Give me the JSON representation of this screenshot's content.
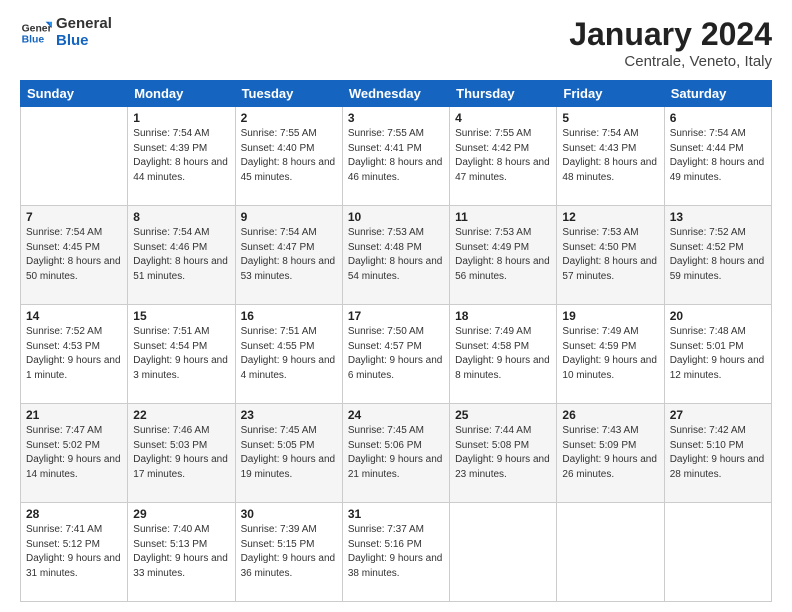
{
  "header": {
    "logo_general": "General",
    "logo_blue": "Blue",
    "month_year": "January 2024",
    "location": "Centrale, Veneto, Italy"
  },
  "days_of_week": [
    "Sunday",
    "Monday",
    "Tuesday",
    "Wednesday",
    "Thursday",
    "Friday",
    "Saturday"
  ],
  "weeks": [
    [
      {
        "day": "",
        "sunrise": "",
        "sunset": "",
        "daylight": ""
      },
      {
        "day": "1",
        "sunrise": "Sunrise: 7:54 AM",
        "sunset": "Sunset: 4:39 PM",
        "daylight": "Daylight: 8 hours and 44 minutes."
      },
      {
        "day": "2",
        "sunrise": "Sunrise: 7:55 AM",
        "sunset": "Sunset: 4:40 PM",
        "daylight": "Daylight: 8 hours and 45 minutes."
      },
      {
        "day": "3",
        "sunrise": "Sunrise: 7:55 AM",
        "sunset": "Sunset: 4:41 PM",
        "daylight": "Daylight: 8 hours and 46 minutes."
      },
      {
        "day": "4",
        "sunrise": "Sunrise: 7:55 AM",
        "sunset": "Sunset: 4:42 PM",
        "daylight": "Daylight: 8 hours and 47 minutes."
      },
      {
        "day": "5",
        "sunrise": "Sunrise: 7:54 AM",
        "sunset": "Sunset: 4:43 PM",
        "daylight": "Daylight: 8 hours and 48 minutes."
      },
      {
        "day": "6",
        "sunrise": "Sunrise: 7:54 AM",
        "sunset": "Sunset: 4:44 PM",
        "daylight": "Daylight: 8 hours and 49 minutes."
      }
    ],
    [
      {
        "day": "7",
        "sunrise": "Sunrise: 7:54 AM",
        "sunset": "Sunset: 4:45 PM",
        "daylight": "Daylight: 8 hours and 50 minutes."
      },
      {
        "day": "8",
        "sunrise": "Sunrise: 7:54 AM",
        "sunset": "Sunset: 4:46 PM",
        "daylight": "Daylight: 8 hours and 51 minutes."
      },
      {
        "day": "9",
        "sunrise": "Sunrise: 7:54 AM",
        "sunset": "Sunset: 4:47 PM",
        "daylight": "Daylight: 8 hours and 53 minutes."
      },
      {
        "day": "10",
        "sunrise": "Sunrise: 7:53 AM",
        "sunset": "Sunset: 4:48 PM",
        "daylight": "Daylight: 8 hours and 54 minutes."
      },
      {
        "day": "11",
        "sunrise": "Sunrise: 7:53 AM",
        "sunset": "Sunset: 4:49 PM",
        "daylight": "Daylight: 8 hours and 56 minutes."
      },
      {
        "day": "12",
        "sunrise": "Sunrise: 7:53 AM",
        "sunset": "Sunset: 4:50 PM",
        "daylight": "Daylight: 8 hours and 57 minutes."
      },
      {
        "day": "13",
        "sunrise": "Sunrise: 7:52 AM",
        "sunset": "Sunset: 4:52 PM",
        "daylight": "Daylight: 8 hours and 59 minutes."
      }
    ],
    [
      {
        "day": "14",
        "sunrise": "Sunrise: 7:52 AM",
        "sunset": "Sunset: 4:53 PM",
        "daylight": "Daylight: 9 hours and 1 minute."
      },
      {
        "day": "15",
        "sunrise": "Sunrise: 7:51 AM",
        "sunset": "Sunset: 4:54 PM",
        "daylight": "Daylight: 9 hours and 3 minutes."
      },
      {
        "day": "16",
        "sunrise": "Sunrise: 7:51 AM",
        "sunset": "Sunset: 4:55 PM",
        "daylight": "Daylight: 9 hours and 4 minutes."
      },
      {
        "day": "17",
        "sunrise": "Sunrise: 7:50 AM",
        "sunset": "Sunset: 4:57 PM",
        "daylight": "Daylight: 9 hours and 6 minutes."
      },
      {
        "day": "18",
        "sunrise": "Sunrise: 7:49 AM",
        "sunset": "Sunset: 4:58 PM",
        "daylight": "Daylight: 9 hours and 8 minutes."
      },
      {
        "day": "19",
        "sunrise": "Sunrise: 7:49 AM",
        "sunset": "Sunset: 4:59 PM",
        "daylight": "Daylight: 9 hours and 10 minutes."
      },
      {
        "day": "20",
        "sunrise": "Sunrise: 7:48 AM",
        "sunset": "Sunset: 5:01 PM",
        "daylight": "Daylight: 9 hours and 12 minutes."
      }
    ],
    [
      {
        "day": "21",
        "sunrise": "Sunrise: 7:47 AM",
        "sunset": "Sunset: 5:02 PM",
        "daylight": "Daylight: 9 hours and 14 minutes."
      },
      {
        "day": "22",
        "sunrise": "Sunrise: 7:46 AM",
        "sunset": "Sunset: 5:03 PM",
        "daylight": "Daylight: 9 hours and 17 minutes."
      },
      {
        "day": "23",
        "sunrise": "Sunrise: 7:45 AM",
        "sunset": "Sunset: 5:05 PM",
        "daylight": "Daylight: 9 hours and 19 minutes."
      },
      {
        "day": "24",
        "sunrise": "Sunrise: 7:45 AM",
        "sunset": "Sunset: 5:06 PM",
        "daylight": "Daylight: 9 hours and 21 minutes."
      },
      {
        "day": "25",
        "sunrise": "Sunrise: 7:44 AM",
        "sunset": "Sunset: 5:08 PM",
        "daylight": "Daylight: 9 hours and 23 minutes."
      },
      {
        "day": "26",
        "sunrise": "Sunrise: 7:43 AM",
        "sunset": "Sunset: 5:09 PM",
        "daylight": "Daylight: 9 hours and 26 minutes."
      },
      {
        "day": "27",
        "sunrise": "Sunrise: 7:42 AM",
        "sunset": "Sunset: 5:10 PM",
        "daylight": "Daylight: 9 hours and 28 minutes."
      }
    ],
    [
      {
        "day": "28",
        "sunrise": "Sunrise: 7:41 AM",
        "sunset": "Sunset: 5:12 PM",
        "daylight": "Daylight: 9 hours and 31 minutes."
      },
      {
        "day": "29",
        "sunrise": "Sunrise: 7:40 AM",
        "sunset": "Sunset: 5:13 PM",
        "daylight": "Daylight: 9 hours and 33 minutes."
      },
      {
        "day": "30",
        "sunrise": "Sunrise: 7:39 AM",
        "sunset": "Sunset: 5:15 PM",
        "daylight": "Daylight: 9 hours and 36 minutes."
      },
      {
        "day": "31",
        "sunrise": "Sunrise: 7:37 AM",
        "sunset": "Sunset: 5:16 PM",
        "daylight": "Daylight: 9 hours and 38 minutes."
      },
      {
        "day": "",
        "sunrise": "",
        "sunset": "",
        "daylight": ""
      },
      {
        "day": "",
        "sunrise": "",
        "sunset": "",
        "daylight": ""
      },
      {
        "day": "",
        "sunrise": "",
        "sunset": "",
        "daylight": ""
      }
    ]
  ]
}
